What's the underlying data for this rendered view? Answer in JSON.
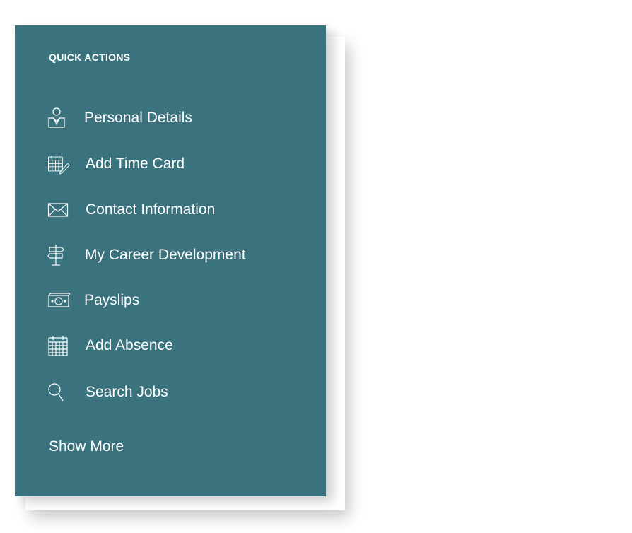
{
  "quick_actions": {
    "title": "QUICK ACTIONS",
    "items": [
      {
        "label": "Personal Details",
        "icon": "person-icon"
      },
      {
        "label": "Add Time Card",
        "icon": "calendar-pen-icon"
      },
      {
        "label": "Contact Information",
        "icon": "envelope-icon"
      },
      {
        "label": "My Career Development",
        "icon": "signpost-icon"
      },
      {
        "label": "Payslips",
        "icon": "banknote-icon"
      },
      {
        "label": "Add Absence",
        "icon": "calendar-icon"
      },
      {
        "label": "Search Jobs",
        "icon": "search-icon"
      }
    ],
    "show_more_label": "Show More"
  },
  "colors": {
    "panel_background": "#3a737e",
    "text": "#ffffff",
    "page_background": "#ffffff"
  }
}
